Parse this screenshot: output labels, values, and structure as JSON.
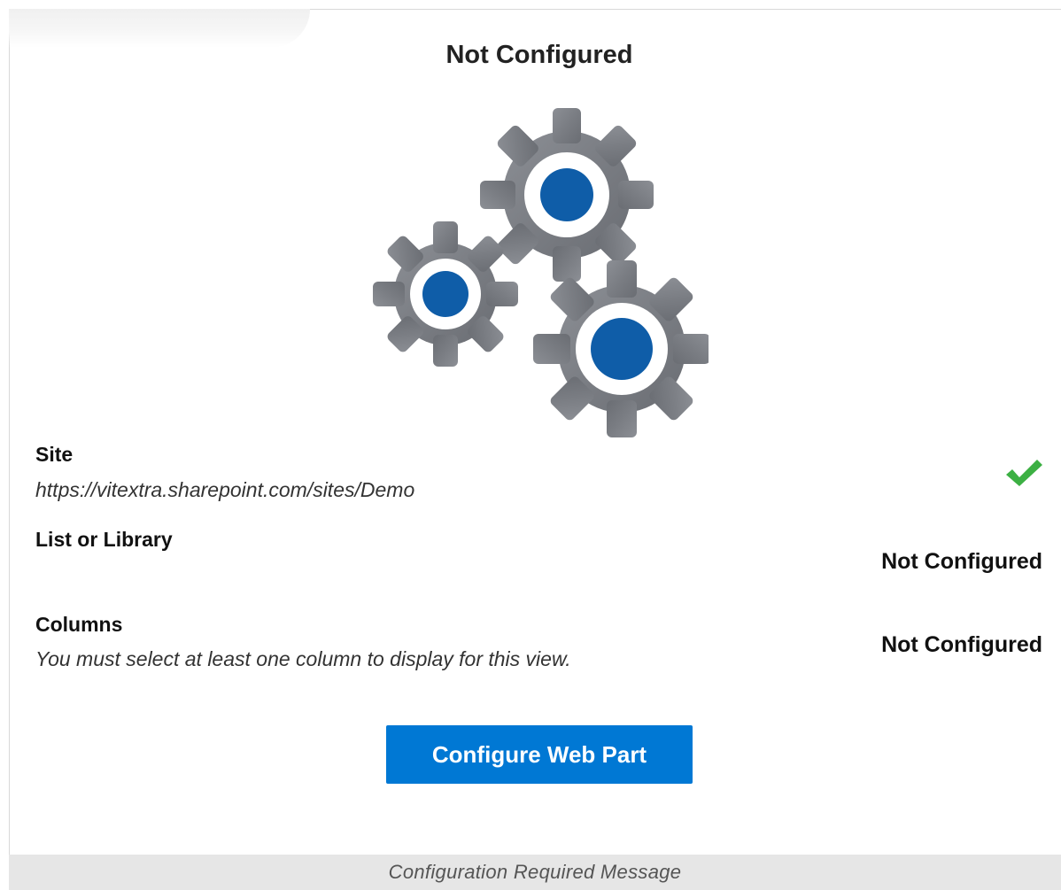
{
  "header": {
    "title": "Not Configured"
  },
  "illustration": {
    "icon": "gears-icon",
    "gear_color": "#7d8086",
    "hub_color": "#0f5da8"
  },
  "site": {
    "label": "Site",
    "value": "https://vitextra.sharepoint.com/sites/Demo",
    "status_icon": "check-icon",
    "status_color": "#3cb043"
  },
  "list": {
    "label": "List or Library",
    "status": "Not Configured"
  },
  "columns": {
    "label": "Columns",
    "hint": "You must select at least one column to display for this view.",
    "status": "Not Configured"
  },
  "actions": {
    "configure_label": "Configure Web Part",
    "accent_color": "#0078d4"
  },
  "caption": {
    "text": "Configuration Required Message"
  }
}
